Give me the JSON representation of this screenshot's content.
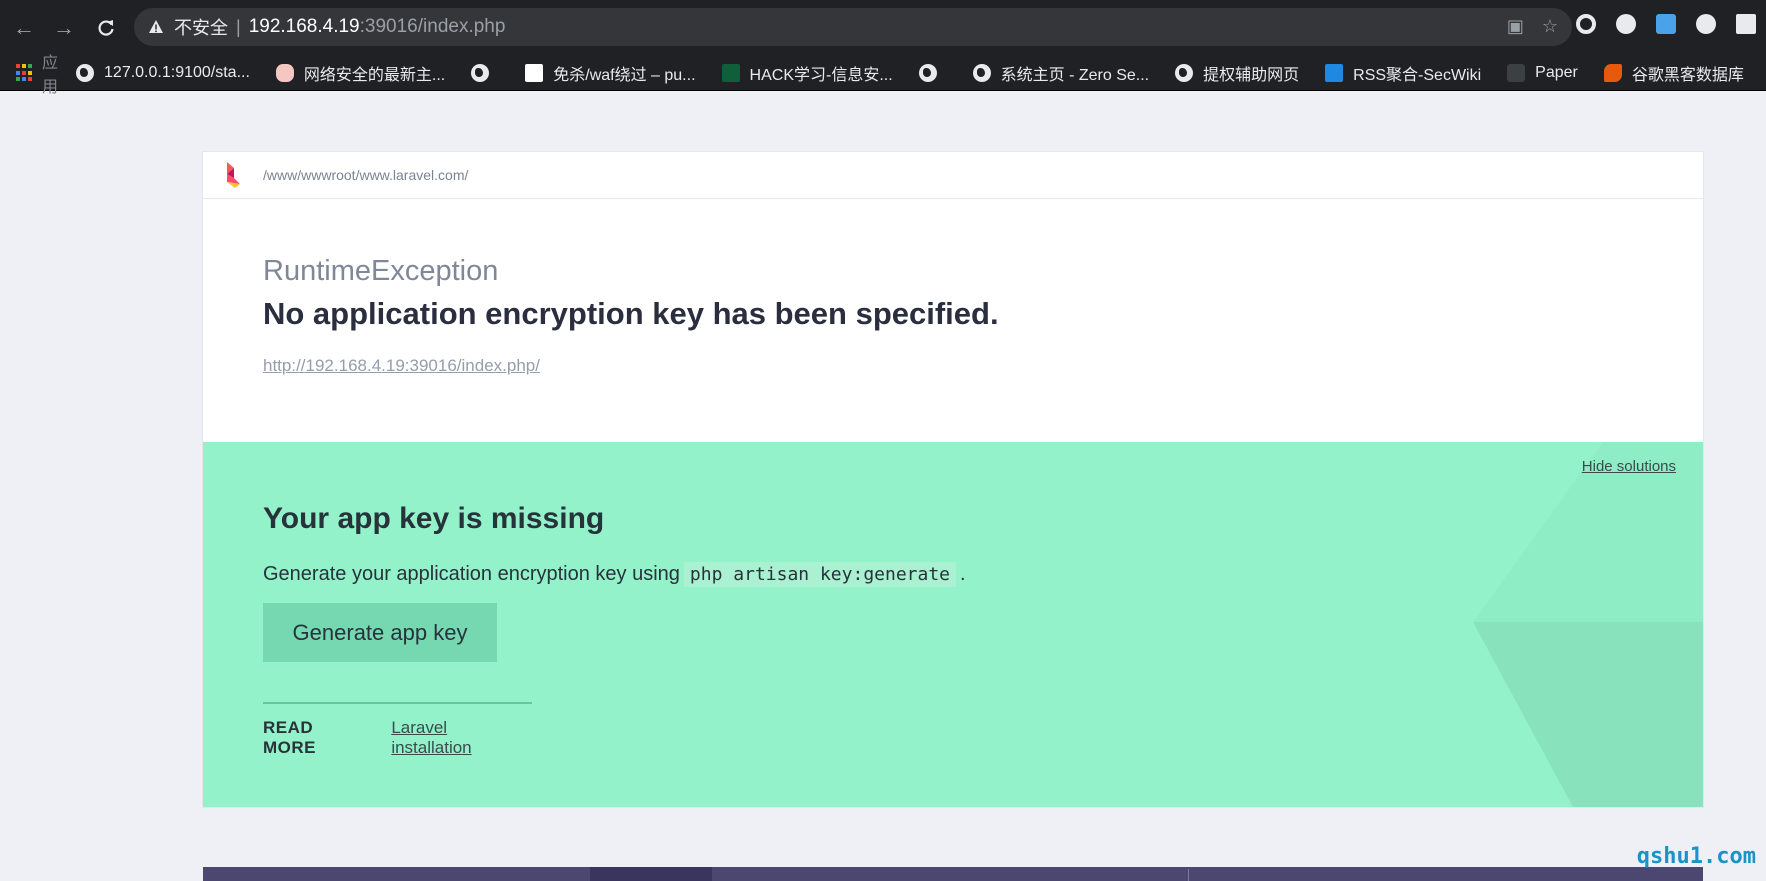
{
  "browser": {
    "security_label": "不安全",
    "separator": "|",
    "url_host": "192.168.4.19",
    "url_rest": ":39016/index.php",
    "bookmarks": {
      "apps_label": "应用",
      "items": [
        {
          "label": "127.0.0.1:9100/sta...",
          "icon": "globe-icon"
        },
        {
          "label": "网络安全的最新主...",
          "icon": "chat-icon"
        },
        {
          "label": "",
          "icon": "globe-icon"
        },
        {
          "label": "免杀/waf绕过 – pu...",
          "icon": "page-icon"
        },
        {
          "label": "HACK学习-信息安...",
          "icon": "hack-icon"
        },
        {
          "label": "",
          "icon": "globe-icon"
        },
        {
          "label": "系统主页 - Zero Se...",
          "icon": "globe-icon"
        },
        {
          "label": "提权辅助网页",
          "icon": "globe-icon"
        },
        {
          "label": "RSS聚合-SecWiki",
          "icon": "secwiki-icon"
        },
        {
          "label": "Paper",
          "icon": "paper-icon"
        },
        {
          "label": "谷歌黑客数据库",
          "icon": "ghdb-icon"
        }
      ]
    }
  },
  "error_page": {
    "path": "/www/wwwroot/www.laravel.com/",
    "exception_class": "RuntimeException",
    "message": "No application encryption key has been specified.",
    "url": "http://192.168.4.19:39016/index.php/"
  },
  "solution": {
    "hide_label": "Hide solutions",
    "title": "Your app key is missing",
    "description_before": "Generate your application encryption key using",
    "command": "php artisan key:generate",
    "description_after": ".",
    "button_label": "Generate app key",
    "read_more_label": "READ MORE",
    "link_label": "Laravel installation"
  },
  "watermark": "qshu1.com",
  "colors": {
    "chrome": "#202124",
    "page_bg": "#eef0f5",
    "solution_bg": "#93f2c9",
    "button_bg": "#75d8b0",
    "heading": "#2a2e3e"
  }
}
